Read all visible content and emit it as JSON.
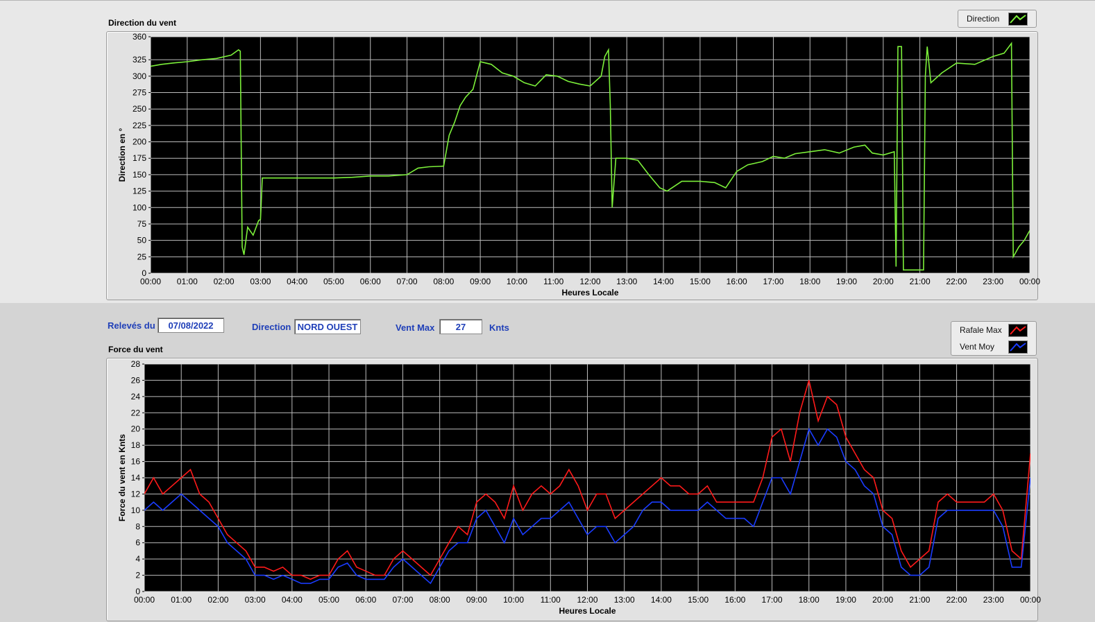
{
  "colors": {
    "direction": "#7cf03a",
    "rafale": "#ff1a1a",
    "vent_moy": "#1a3cff",
    "label_blue": "#1f3fb8"
  },
  "info": {
    "releves_label": "Relevés du",
    "date": "07/08/2022",
    "direction_label": "Direction",
    "direction_value": "NORD OUEST",
    "ventmax_label": "Vent Max",
    "ventmax_value": "27",
    "ventmax_unit": "Knts"
  },
  "legend_top": {
    "items": [
      {
        "label": "Direction"
      }
    ]
  },
  "legend_bottom": {
    "items": [
      {
        "label": "Rafale Max"
      },
      {
        "label": "Vent Moy"
      }
    ]
  },
  "chart_data": [
    {
      "type": "line",
      "title": "Direction du vent",
      "xlabel": "Heures Locale",
      "ylabel": "Direction en °",
      "xlim": [
        0,
        24
      ],
      "ylim": [
        0,
        360
      ],
      "yticks": [
        0,
        25,
        50,
        75,
        100,
        125,
        150,
        175,
        200,
        225,
        250,
        275,
        300,
        325,
        360
      ],
      "xticks": [
        "00:00",
        "01:00",
        "02:00",
        "03:00",
        "04:00",
        "05:00",
        "06:00",
        "07:00",
        "08:00",
        "09:00",
        "10:00",
        "11:00",
        "12:00",
        "13:00",
        "14:00",
        "15:00",
        "16:00",
        "17:00",
        "18:00",
        "19:00",
        "20:00",
        "21:00",
        "22:00",
        "23:00",
        "00:00"
      ],
      "grid": true,
      "legend": "top-right",
      "series": [
        {
          "name": "Direction",
          "x": [
            0,
            0.3,
            0.6,
            1.0,
            1.4,
            1.8,
            2.2,
            2.4,
            2.45,
            2.5,
            2.55,
            2.65,
            2.8,
            2.95,
            3.0,
            3.05,
            3.5,
            4.0,
            4.5,
            5.0,
            5.5,
            6.0,
            6.5,
            7.0,
            7.3,
            7.6,
            8.0,
            8.15,
            8.3,
            8.45,
            8.6,
            8.8,
            9.0,
            9.3,
            9.6,
            9.9,
            10.2,
            10.5,
            10.8,
            11.1,
            11.4,
            11.7,
            12.0,
            12.3,
            12.4,
            12.5,
            12.55,
            12.6,
            12.7,
            13.0,
            13.3,
            13.6,
            13.9,
            14.1,
            14.5,
            15.0,
            15.4,
            15.7,
            16.0,
            16.3,
            16.7,
            17.0,
            17.3,
            17.6,
            18.0,
            18.4,
            18.8,
            19.2,
            19.5,
            19.7,
            20.0,
            20.3,
            20.35,
            20.4,
            20.5,
            20.55,
            20.6,
            20.65,
            21.0,
            21.1,
            21.15,
            21.2,
            21.3,
            21.6,
            22.0,
            22.5,
            23.0,
            23.3,
            23.5,
            23.55,
            23.6,
            23.7,
            23.85,
            24.0
          ],
          "y": [
            315,
            318,
            320,
            322,
            325,
            327,
            332,
            340,
            338,
            40,
            28,
            70,
            58,
            80,
            82,
            145,
            145,
            145,
            145,
            145,
            146,
            148,
            148,
            150,
            160,
            162,
            163,
            210,
            230,
            255,
            268,
            280,
            322,
            318,
            305,
            300,
            290,
            285,
            302,
            300,
            292,
            288,
            285,
            300,
            330,
            340,
            255,
            100,
            175,
            175,
            172,
            150,
            130,
            125,
            140,
            140,
            138,
            130,
            155,
            165,
            170,
            178,
            175,
            182,
            185,
            188,
            183,
            192,
            195,
            183,
            180,
            185,
            10,
            345,
            345,
            5,
            5,
            5,
            5,
            5,
            300,
            345,
            290,
            305,
            320,
            318,
            330,
            335,
            350,
            25,
            30,
            40,
            50,
            65
          ]
        }
      ]
    },
    {
      "type": "line",
      "title": "Force du vent",
      "xlabel": "Heures Locale",
      "ylabel": "Force du vent en Knts",
      "xlim": [
        0,
        24
      ],
      "ylim": [
        0,
        28
      ],
      "yticks": [
        0,
        2,
        4,
        6,
        8,
        10,
        12,
        14,
        16,
        18,
        20,
        22,
        24,
        26,
        28
      ],
      "xticks": [
        "00:00",
        "01:00",
        "02:00",
        "03:00",
        "04:00",
        "05:00",
        "06:00",
        "07:00",
        "08:00",
        "09:00",
        "10:00",
        "11:00",
        "12:00",
        "13:00",
        "14:00",
        "15:00",
        "16:00",
        "17:00",
        "18:00",
        "19:00",
        "20:00",
        "21:00",
        "22:00",
        "23:00",
        "00:00"
      ],
      "grid": true,
      "legend": "top-right",
      "series": [
        {
          "name": "Rafale Max",
          "x": [
            0,
            0.25,
            0.5,
            0.75,
            1.0,
            1.25,
            1.5,
            1.75,
            2.0,
            2.25,
            2.5,
            2.75,
            3.0,
            3.25,
            3.5,
            3.75,
            4.0,
            4.25,
            4.5,
            4.75,
            5.0,
            5.25,
            5.5,
            5.75,
            6.0,
            6.25,
            6.5,
            6.75,
            7.0,
            7.25,
            7.5,
            7.75,
            8.0,
            8.25,
            8.5,
            8.75,
            9.0,
            9.25,
            9.5,
            9.75,
            10.0,
            10.25,
            10.5,
            10.75,
            11.0,
            11.25,
            11.5,
            11.75,
            12.0,
            12.25,
            12.5,
            12.75,
            13.0,
            13.25,
            13.5,
            13.75,
            14.0,
            14.25,
            14.5,
            14.75,
            15.0,
            15.25,
            15.5,
            15.75,
            16.0,
            16.25,
            16.5,
            16.75,
            17.0,
            17.25,
            17.5,
            17.75,
            18.0,
            18.25,
            18.5,
            18.75,
            19.0,
            19.25,
            19.5,
            19.75,
            20.0,
            20.25,
            20.5,
            20.75,
            21.0,
            21.25,
            21.5,
            21.75,
            22.0,
            22.25,
            22.5,
            22.75,
            23.0,
            23.25,
            23.5,
            23.75,
            24.0
          ],
          "y": [
            12,
            14,
            12,
            13,
            14,
            15,
            12,
            11,
            9,
            7,
            6,
            5,
            3,
            3,
            2.5,
            3,
            2,
            2,
            1.5,
            2,
            2,
            4,
            5,
            3,
            2.5,
            2,
            2,
            4,
            5,
            4,
            3,
            2,
            4,
            6,
            8,
            7,
            11,
            12,
            11,
            9,
            13,
            10,
            12,
            13,
            12,
            13,
            15,
            13,
            10,
            12,
            12,
            9,
            10,
            11,
            12,
            13,
            14,
            13,
            13,
            12,
            12,
            13,
            11,
            11,
            11,
            11,
            11,
            14,
            19,
            20,
            16,
            22,
            26,
            21,
            24,
            23,
            19,
            17,
            15,
            14,
            10,
            9,
            5,
            3,
            4,
            5,
            11,
            12,
            11,
            11,
            11,
            11,
            12,
            10,
            5,
            4,
            17
          ]
        },
        {
          "name": "Vent Moy",
          "x": [
            0,
            0.25,
            0.5,
            0.75,
            1.0,
            1.25,
            1.5,
            1.75,
            2.0,
            2.25,
            2.5,
            2.75,
            3.0,
            3.25,
            3.5,
            3.75,
            4.0,
            4.25,
            4.5,
            4.75,
            5.0,
            5.25,
            5.5,
            5.75,
            6.0,
            6.25,
            6.5,
            6.75,
            7.0,
            7.25,
            7.5,
            7.75,
            8.0,
            8.25,
            8.5,
            8.75,
            9.0,
            9.25,
            9.5,
            9.75,
            10.0,
            10.25,
            10.5,
            10.75,
            11.0,
            11.25,
            11.5,
            11.75,
            12.0,
            12.25,
            12.5,
            12.75,
            13.0,
            13.25,
            13.5,
            13.75,
            14.0,
            14.25,
            14.5,
            14.75,
            15.0,
            15.25,
            15.5,
            15.75,
            16.0,
            16.25,
            16.5,
            16.75,
            17.0,
            17.25,
            17.5,
            17.75,
            18.0,
            18.25,
            18.5,
            18.75,
            19.0,
            19.25,
            19.5,
            19.75,
            20.0,
            20.25,
            20.5,
            20.75,
            21.0,
            21.25,
            21.5,
            21.75,
            22.0,
            22.25,
            22.5,
            22.75,
            23.0,
            23.25,
            23.5,
            23.75,
            24.0
          ],
          "y": [
            10,
            11,
            10,
            11,
            12,
            11,
            10,
            9,
            8,
            6,
            5,
            4,
            2,
            2,
            1.5,
            2,
            1.5,
            1,
            1,
            1.5,
            1.5,
            3,
            3.5,
            2,
            1.5,
            1.5,
            1.5,
            3,
            4,
            3,
            2,
            1,
            3,
            5,
            6,
            6,
            9,
            10,
            8,
            6,
            9,
            7,
            8,
            9,
            9,
            10,
            11,
            9,
            7,
            8,
            8,
            6,
            7,
            8,
            10,
            11,
            11,
            10,
            10,
            10,
            10,
            11,
            10,
            9,
            9,
            9,
            8,
            11,
            14,
            14,
            12,
            16,
            20,
            18,
            20,
            19,
            16,
            15,
            13,
            12,
            8,
            7,
            3,
            2,
            2,
            3,
            9,
            10,
            10,
            10,
            10,
            10,
            10,
            8,
            3,
            3,
            14
          ]
        }
      ]
    }
  ]
}
